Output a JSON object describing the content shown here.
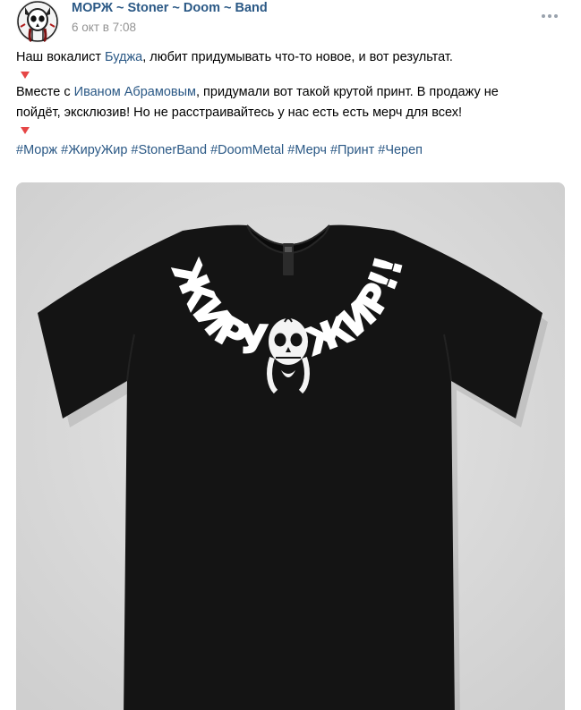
{
  "post": {
    "author": "МОРЖ ~ Stoner ~ Doom ~ Band",
    "date": "6 окт в 7:08",
    "text": {
      "line1": {
        "before": "Наш вокалист ",
        "link": "Буджа",
        "after": ", любит придумывать что-то новое, и вот результат."
      },
      "line2": {
        "before": "Вместе с ",
        "link": "Иваном Абрамовым",
        "after": ", придумали вот такой крутой принт. В продажу не"
      },
      "line3": "пойдёт, эксклюзив! Но не расстраивайтесь у нас есть есть мерч для всех!"
    },
    "hashtags": [
      "#Морж",
      "#ЖируЖир",
      "#StonerBand",
      "#DoomMetal",
      "#Мерч",
      "#Принт",
      "#Череп"
    ]
  },
  "image": {
    "print_text_left": "ЖИРУ",
    "print_text_right": "ЖИР!!!"
  },
  "icons": {
    "more": "more-horizontal-icon",
    "triangle": "red-triangle-down-icon"
  },
  "colors": {
    "link": "#2a5885",
    "meta": "#939393",
    "triangle": "#e64646",
    "shirt": "#141414",
    "photo_bg": "#dcdcdc"
  }
}
